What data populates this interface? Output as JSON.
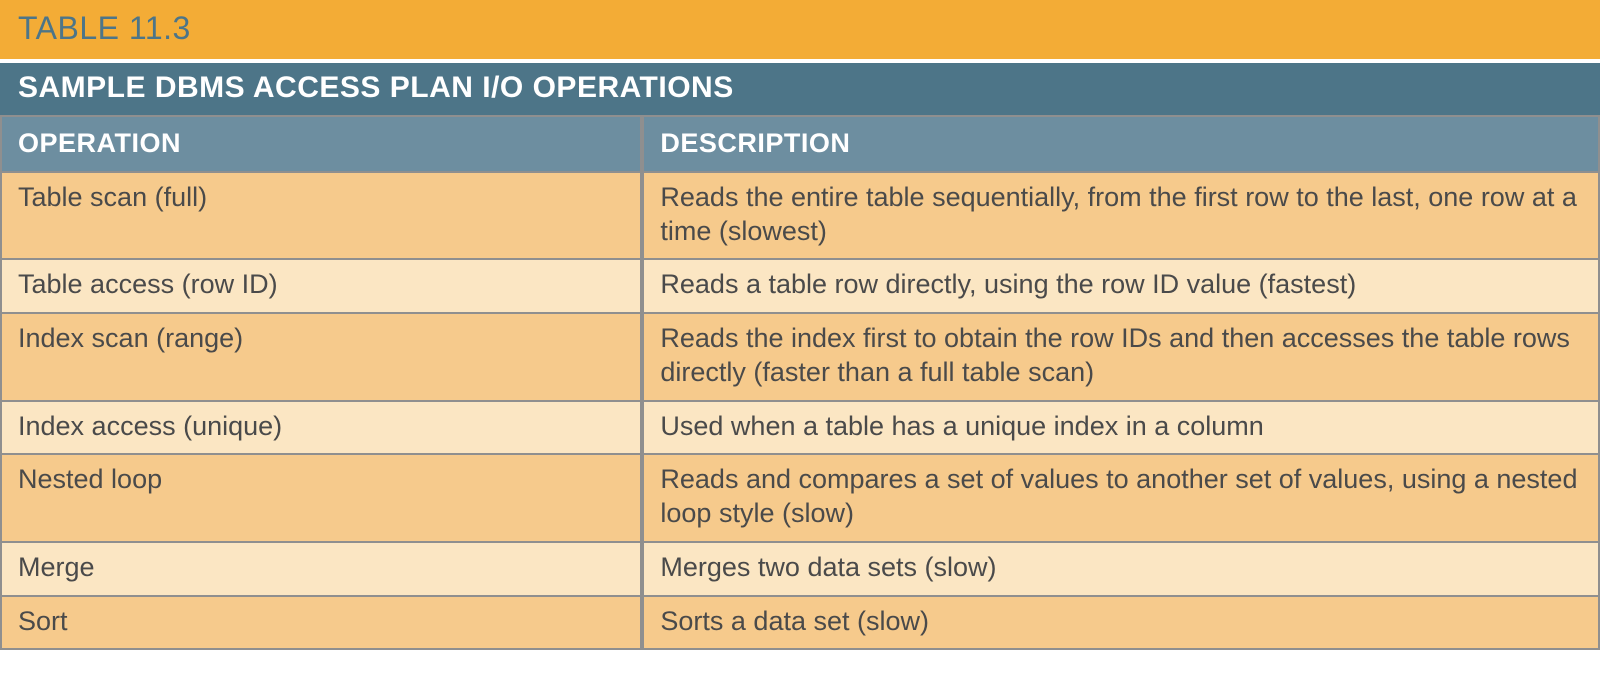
{
  "caption": "TABLE 11.3",
  "title": "SAMPLE DBMS ACCESS PLAN I/O OPERATIONS",
  "columns": {
    "operation": "OPERATION",
    "description": "DESCRIPTION"
  },
  "rows": [
    {
      "operation": "Table scan (full)",
      "description": "Reads the entire table sequentially, from the first row to the last, one row at a time (slowest)"
    },
    {
      "operation": "Table access (row ID)",
      "description": "Reads a table row directly, using the row ID value (fastest)"
    },
    {
      "operation": "Index scan (range)",
      "description": "Reads the index first to obtain the row IDs and then accesses the table rows directly (faster than a full table scan)"
    },
    {
      "operation": "Index access (unique)",
      "description": "Used when a table has a unique index in a column"
    },
    {
      "operation": "Nested loop",
      "description": "Reads and compares a set of values to another set of values, using a nested loop style (slow)"
    },
    {
      "operation": "Merge",
      "description": "Merges two data sets (slow)"
    },
    {
      "operation": "Sort",
      "description": "Sorts a data set (slow)"
    }
  ],
  "colors": {
    "caption_bg": "#f3ac36",
    "caption_fg": "#4d7588",
    "title_bg": "#4d7588",
    "header_bg": "#6d8ea0",
    "row_dark": "#f6ca8c",
    "row_light": "#fbe6c3",
    "grid": "#8f8f8f"
  }
}
